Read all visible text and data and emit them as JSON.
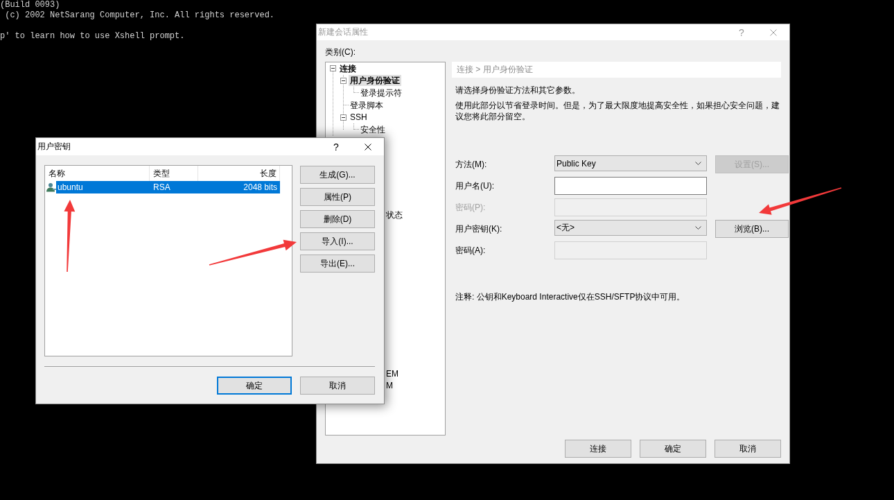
{
  "terminal": {
    "blocks": [
      [
        "(Build 0093)",
        " (c) 2002 NetSarang Computer, Inc. All rights reserved."
      ],
      [
        "p' to learn how to use Xshell prompt."
      ]
    ]
  },
  "session_dialog": {
    "title": "新建会话属性",
    "active": false,
    "help": "?",
    "category_label": "类别(C):",
    "tree": {
      "items": [
        {
          "label": "连接",
          "expanded": true,
          "selected": false,
          "children": [
            {
              "label": "用户身份验证",
              "expanded": true,
              "selected": true,
              "children": [
                {
                  "label": "登录提示符",
                  "selected": false
                }
              ]
            },
            {
              "label": "登录脚本",
              "selected": false
            },
            {
              "label": "SSH",
              "expanded": true,
              "selected": false,
              "children": [
                {
                  "label": "安全性",
                  "selected": false
                }
              ]
            }
          ]
        }
      ],
      "partial_items": [
        {
          "label": "状态",
          "selected": false
        },
        {
          "label": "EM",
          "selected": false
        },
        {
          "label": "M",
          "selected": false
        }
      ]
    },
    "breadcrumb": "连接 > 用户身份验证",
    "intro": "请选择身份验证方法和其它参数。",
    "description": "使用此部分以节省登录时间。但是，为了最大限度地提高安全性，如果担心安全问题，建议您将此部分留空。",
    "form": [
      {
        "label": "方法(M):",
        "label_disabled": false,
        "field": {
          "kind": "select",
          "value": "Public Key",
          "disabled": false
        },
        "button": {
          "label": "设置(S)...",
          "disabled": true
        }
      },
      {
        "label": "用户名(U):",
        "label_disabled": false,
        "field": {
          "kind": "input",
          "disabled": false
        }
      },
      {
        "label": "密码(P):",
        "label_disabled": true,
        "field": {
          "kind": "input",
          "disabled": true
        }
      },
      {
        "label": "用户密钥(K):",
        "label_disabled": false,
        "field": {
          "kind": "select",
          "value": "<无>",
          "disabled": false
        },
        "button": {
          "label": "浏览(B)...",
          "disabled": false
        }
      },
      {
        "label": "密码(A):",
        "label_disabled": false,
        "field": {
          "kind": "input",
          "disabled": true
        }
      }
    ],
    "note": "注释: 公钥和Keyboard Interactive仅在SSH/SFTP协议中可用。",
    "buttons": [
      {
        "label": "连接",
        "default": false
      },
      {
        "label": "确定",
        "default": false
      },
      {
        "label": "取消",
        "default": false
      }
    ]
  },
  "key_dialog": {
    "title": "用户密钥",
    "active": true,
    "help": "?",
    "list": {
      "columns": [
        "名称",
        "类型",
        "长度"
      ],
      "rows": [
        {
          "cells": [
            "ubuntu",
            "RSA",
            "2048 bits"
          ],
          "selected": true
        }
      ]
    },
    "side_buttons": [
      "生成(G)...",
      "属性(P)",
      "删除(D)",
      "导入(I)...",
      "导出(E)..."
    ],
    "buttons": [
      {
        "label": "确定",
        "default": true
      },
      {
        "label": "取消",
        "default": false
      }
    ]
  },
  "annotations": [
    {
      "kind": "arrow"
    },
    {
      "kind": "arrow"
    },
    {
      "kind": "arrow"
    }
  ]
}
